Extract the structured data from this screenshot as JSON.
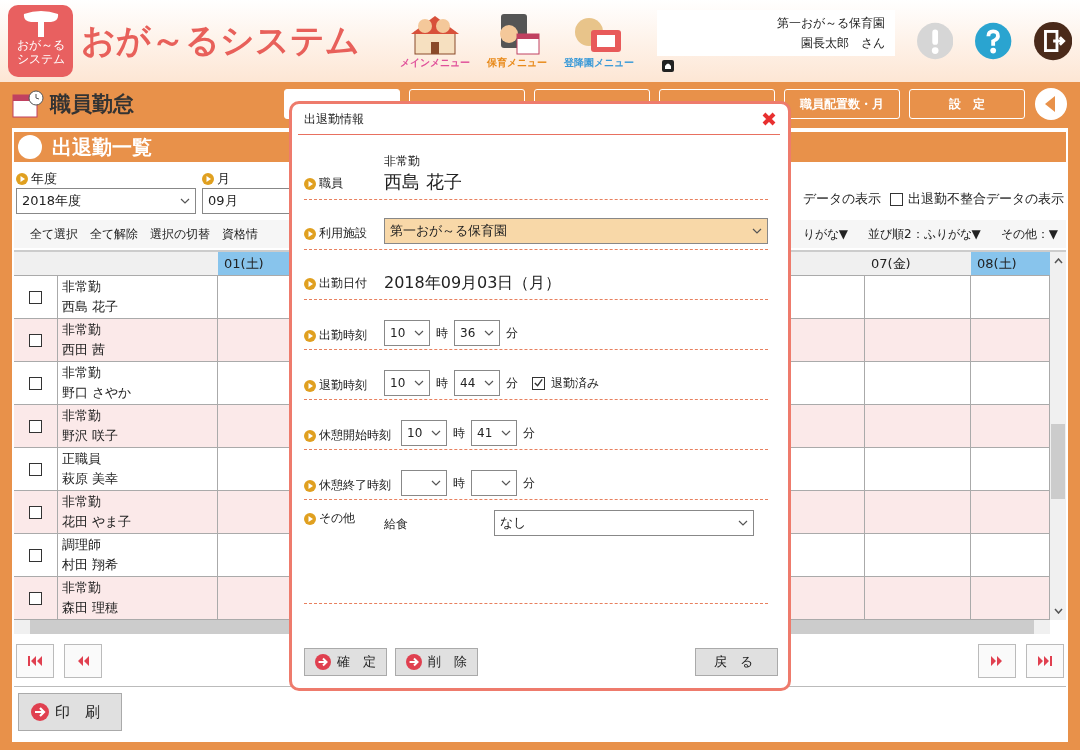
{
  "header": {
    "logo_lines": [
      "おが～る",
      "システム"
    ],
    "app_title": "おが～るシステム",
    "menu_buttons": [
      {
        "label": "メインメニュー",
        "kind": "house",
        "color": "#e0509a"
      },
      {
        "label": "保育メニュー",
        "kind": "calendar",
        "color": "#e88a1a"
      },
      {
        "label": "登降園メニュー",
        "kind": "card",
        "color": "#3a9ad8"
      }
    ],
    "facility": "第一おが～る保育園",
    "user": "園長太郎　さん"
  },
  "page_title": "職員勤怠",
  "tabs": [
    {
      "label": "職員配置数・月",
      "selected": false
    },
    {
      "label": "設　定",
      "selected": false
    }
  ],
  "section_title": "出退勤一覧",
  "filters": {
    "year": {
      "label": "年度",
      "value": "2018年度"
    },
    "month": {
      "label": "月",
      "value": "09月"
    },
    "cut_label": "データの表示",
    "mismatch": {
      "label": "出退勤不整合データの表示",
      "checked": false
    }
  },
  "toolbar_left": [
    "全て選択",
    "全て解除",
    "選択の切替",
    "資格情"
  ],
  "toolbar_right": [
    "りがな▼",
    "並び順2：ふりがな▼",
    "その他：▼"
  ],
  "table": {
    "left_day": {
      "label": "01(土)",
      "weekend": true
    },
    "right_days": [
      {
        "label": "07(金)",
        "weekend": false
      },
      {
        "label": "08(土)",
        "weekend": true
      }
    ],
    "rows": [
      {
        "type": "非常勤",
        "name": "西島 花子",
        "checked": false
      },
      {
        "type": "非常勤",
        "name": "西田 茜",
        "checked": false
      },
      {
        "type": "非常勤",
        "name": "野口 さやか",
        "checked": false
      },
      {
        "type": "非常勤",
        "name": "野沢 咲子",
        "checked": false
      },
      {
        "type": "正職員",
        "name": "萩原 美幸",
        "checked": false
      },
      {
        "type": "非常勤",
        "name": "花田 やま子",
        "checked": false
      },
      {
        "type": "調理師",
        "name": "村田 翔希",
        "checked": false
      },
      {
        "type": "非常勤",
        "name": "森田 理穂",
        "checked": false
      }
    ]
  },
  "print_button": "印　刷",
  "modal": {
    "title": "出退勤情報",
    "fields": [
      {
        "kind": "staff",
        "label": "職員",
        "sub": "非常勤",
        "value": "西島 花子"
      },
      {
        "kind": "select",
        "label": "利用施設",
        "value": "第一おが～る保育園"
      },
      {
        "kind": "text",
        "label": "出勤日付",
        "value": "2018年09月03日（月）"
      },
      {
        "kind": "time",
        "label": "出勤時刻",
        "hour": "10",
        "minute": "36",
        "hour_unit": "時",
        "minute_unit": "分"
      },
      {
        "kind": "time",
        "label": "退勤時刻",
        "hour": "10",
        "minute": "44",
        "hour_unit": "時",
        "minute_unit": "分",
        "check": {
          "label": "退勤済み",
          "checked": true
        }
      },
      {
        "kind": "time",
        "label": "休憩開始時刻",
        "hour": "10",
        "minute": "41",
        "hour_unit": "時",
        "minute_unit": "分"
      },
      {
        "kind": "time",
        "label": "休憩終了時刻",
        "hour_unit": "時",
        "minute_unit": "分"
      },
      {
        "kind": "other",
        "label": "その他",
        "item": "給食",
        "value": "なし"
      }
    ],
    "buttons": [
      "確　定",
      "削　除"
    ],
    "back_button": "戻　る"
  }
}
